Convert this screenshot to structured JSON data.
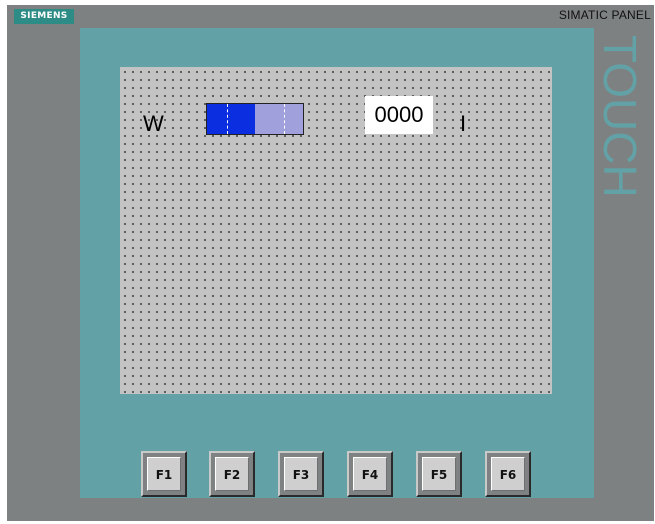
{
  "header": {
    "brand": "SIEMENS",
    "model": "SIMATIC PANEL",
    "side_text": "TOUCH"
  },
  "screen": {
    "label_left": "W",
    "label_right": "I",
    "number_value": "0000",
    "bar_level": 0.5
  },
  "function_keys": [
    "F1",
    "F2",
    "F3",
    "F4",
    "F5",
    "F6"
  ],
  "colors": {
    "body": "#7e8182",
    "bezel": "#62a1a6",
    "screen": "#c3c3c3",
    "bar_fill": "#0a2ee0",
    "bar_bg": "#a0a0dc",
    "logo_bg": "#2e8c86"
  }
}
